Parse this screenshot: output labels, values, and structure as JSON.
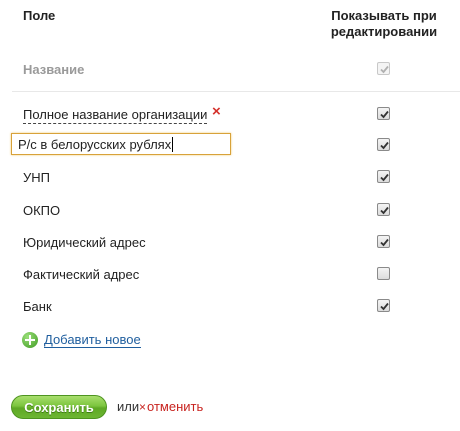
{
  "header": {
    "field_col": "Поле",
    "show_col_line1": "Показывать при",
    "show_col_line2": "редактировании"
  },
  "rows": [
    {
      "label": "Название",
      "checked": true,
      "disabled": true
    },
    {
      "label": "Полное название организации",
      "checked": true,
      "deletable": true
    },
    {
      "label": "Р/с в белорусских рублях",
      "checked": true,
      "editing": true
    },
    {
      "label": "УНП",
      "checked": true
    },
    {
      "label": "ОКПО",
      "checked": true
    },
    {
      "label": "Юридический адрес",
      "checked": true
    },
    {
      "label": "Фактический адрес",
      "checked": false
    },
    {
      "label": "Банк",
      "checked": true
    }
  ],
  "add_new_label": "Добавить новое",
  "footer": {
    "save_label": "Сохранить",
    "or_label": "или",
    "cancel_symbol": "×",
    "cancel_label": "отменить"
  },
  "colors": {
    "accent_green": "#6db633",
    "link_blue": "#1f5e9e",
    "cancel_red": "#c8231f",
    "edit_border": "#d8a23a"
  }
}
